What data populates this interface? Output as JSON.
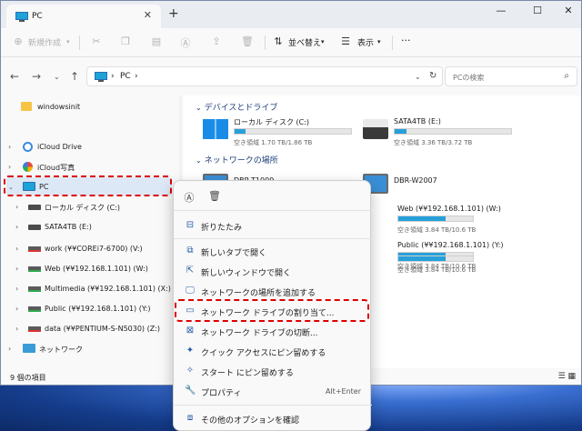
{
  "window": {
    "tab_title": "PC",
    "new_tab": "+",
    "minimize": "—",
    "maximize": "☐",
    "close": "✕"
  },
  "toolbar": {
    "new_label": "新規作成",
    "sort_label": "並べ替え",
    "view_label": "表示",
    "more": "···"
  },
  "address": {
    "crumb_sep": "›",
    "location": "PC",
    "search_placeholder": "PCの検索"
  },
  "sidebar": {
    "items": [
      {
        "label": "windowsinit",
        "icon": "folder-icon"
      },
      {
        "label": "iCloud Drive",
        "icon": "cloud-icon"
      },
      {
        "label": "iCloud写真",
        "icon": "photos-icon"
      },
      {
        "label": "PC",
        "icon": "pc-icon"
      },
      {
        "label": "ローカル ディスク (C:)",
        "icon": "drive-icon"
      },
      {
        "label": "SATA4TB (E:)",
        "icon": "drive-icon"
      },
      {
        "label": "work (¥¥COREi7-6700) (V:)",
        "icon": "network-drive-icon"
      },
      {
        "label": "Web (¥¥192.168.1.101) (W:)",
        "icon": "network-drive-icon"
      },
      {
        "label": "Multimedia (¥¥192.168.1.101) (X:)",
        "icon": "network-drive-icon"
      },
      {
        "label": "Public (¥¥192.168.1.101) (Y:)",
        "icon": "network-drive-icon"
      },
      {
        "label": "data (¥¥PENTIUM-S-N5030) (Z:)",
        "icon": "network-drive-icon"
      },
      {
        "label": "ネットワーク",
        "icon": "network-icon"
      }
    ]
  },
  "status": {
    "item_count": "9 個の項目"
  },
  "main": {
    "devices_header": "デバイスとドライブ",
    "network_header": "ネットワークの場所",
    "drives": [
      {
        "name": "ローカル ディスク (C:)",
        "free": "空き領域 1.70 TB/1.86 TB",
        "used_fraction": 0.09
      },
      {
        "name": "SATA4TB (E:)",
        "free": "空き領域 3.36 TB/3.72 TB",
        "used_fraction": 0.1
      }
    ],
    "network": [
      {
        "name": "DBR-T1009"
      },
      {
        "name": "DBR-W2007"
      },
      {
        "name": "Web (¥¥192.168.1.101) (W:)",
        "free": "空き領域 3.84 TB/10.6 TB",
        "used_fraction": 0.64
      },
      {
        "name": "Public (¥¥192.168.1.101) (Y:)",
        "free": "空き領域 3.84 TB/10.6 TB",
        "used_fraction": 0.64
      },
      {
        "free": "空き領域 3.84 TB/10.6 TB",
        "used_fraction": 0.64
      }
    ]
  },
  "context_menu": {
    "items": [
      {
        "label": "折りたたみ",
        "icon": "collapse-icon"
      },
      {
        "label": "新しいタブで開く",
        "icon": "new-tab-icon"
      },
      {
        "label": "新しいウィンドウで開く",
        "icon": "new-window-icon"
      },
      {
        "label": "ネットワークの場所を追加する",
        "icon": "add-network-location-icon"
      },
      {
        "label": "ネットワーク ドライブの割り当て...",
        "icon": "map-network-drive-icon"
      },
      {
        "label": "ネットワーク ドライブの切断...",
        "icon": "disconnect-network-drive-icon"
      },
      {
        "label": "クイック アクセスにピン留めする",
        "icon": "pin-icon"
      },
      {
        "label": "スタート にピン留めする",
        "icon": "pin-start-icon"
      },
      {
        "label": "プロパティ",
        "icon": "properties-icon",
        "shortcut": "Alt+Enter"
      },
      {
        "label": "その他のオプションを確認",
        "icon": "more-options-icon"
      }
    ]
  },
  "colors": {
    "highlight_box": "#d00000",
    "accent": "#26a0da"
  }
}
